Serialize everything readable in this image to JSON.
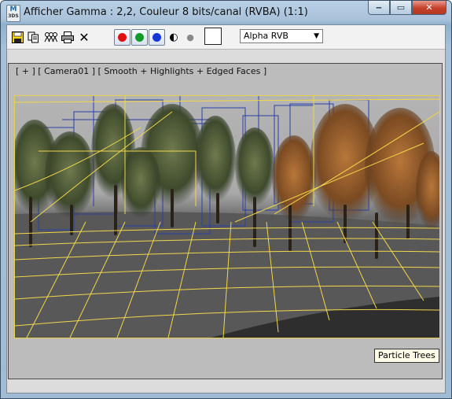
{
  "window": {
    "title": "Afficher Gamma : 2,2, Couleur 8 bits/canal (RVBA) (1:1)",
    "app_icon": {
      "main": "M",
      "sub": "3DS"
    },
    "buttons": {
      "minimize": "‒",
      "maximize": "▭",
      "close": "✕"
    }
  },
  "toolbar": {
    "icons": [
      "save-icon",
      "copy-icon",
      "clone-icon",
      "print-icon",
      "clear-icon"
    ],
    "clear_glyph": "✕",
    "channels": [
      {
        "name": "red-channel",
        "color": "#e01010"
      },
      {
        "name": "green-channel",
        "color": "#119c2a"
      },
      {
        "name": "blue-channel",
        "color": "#1438d8"
      }
    ],
    "display_alpha_glyph": "◐",
    "mono_glyph": "●",
    "swatch_color": "#ffffff",
    "channel_select": {
      "value": "Alpha RVB"
    }
  },
  "viewport": {
    "label": "[ + ] [ Camera01 ] [ Smooth + Highlights + Edged Faces ]",
    "object_tag": "Particle Trees",
    "colors": {
      "wire_yellow": "#f2d74a",
      "wire_blue": "#2a3fa8",
      "sky": "#b4b4b4",
      "ground": "#5c5c5c"
    }
  }
}
